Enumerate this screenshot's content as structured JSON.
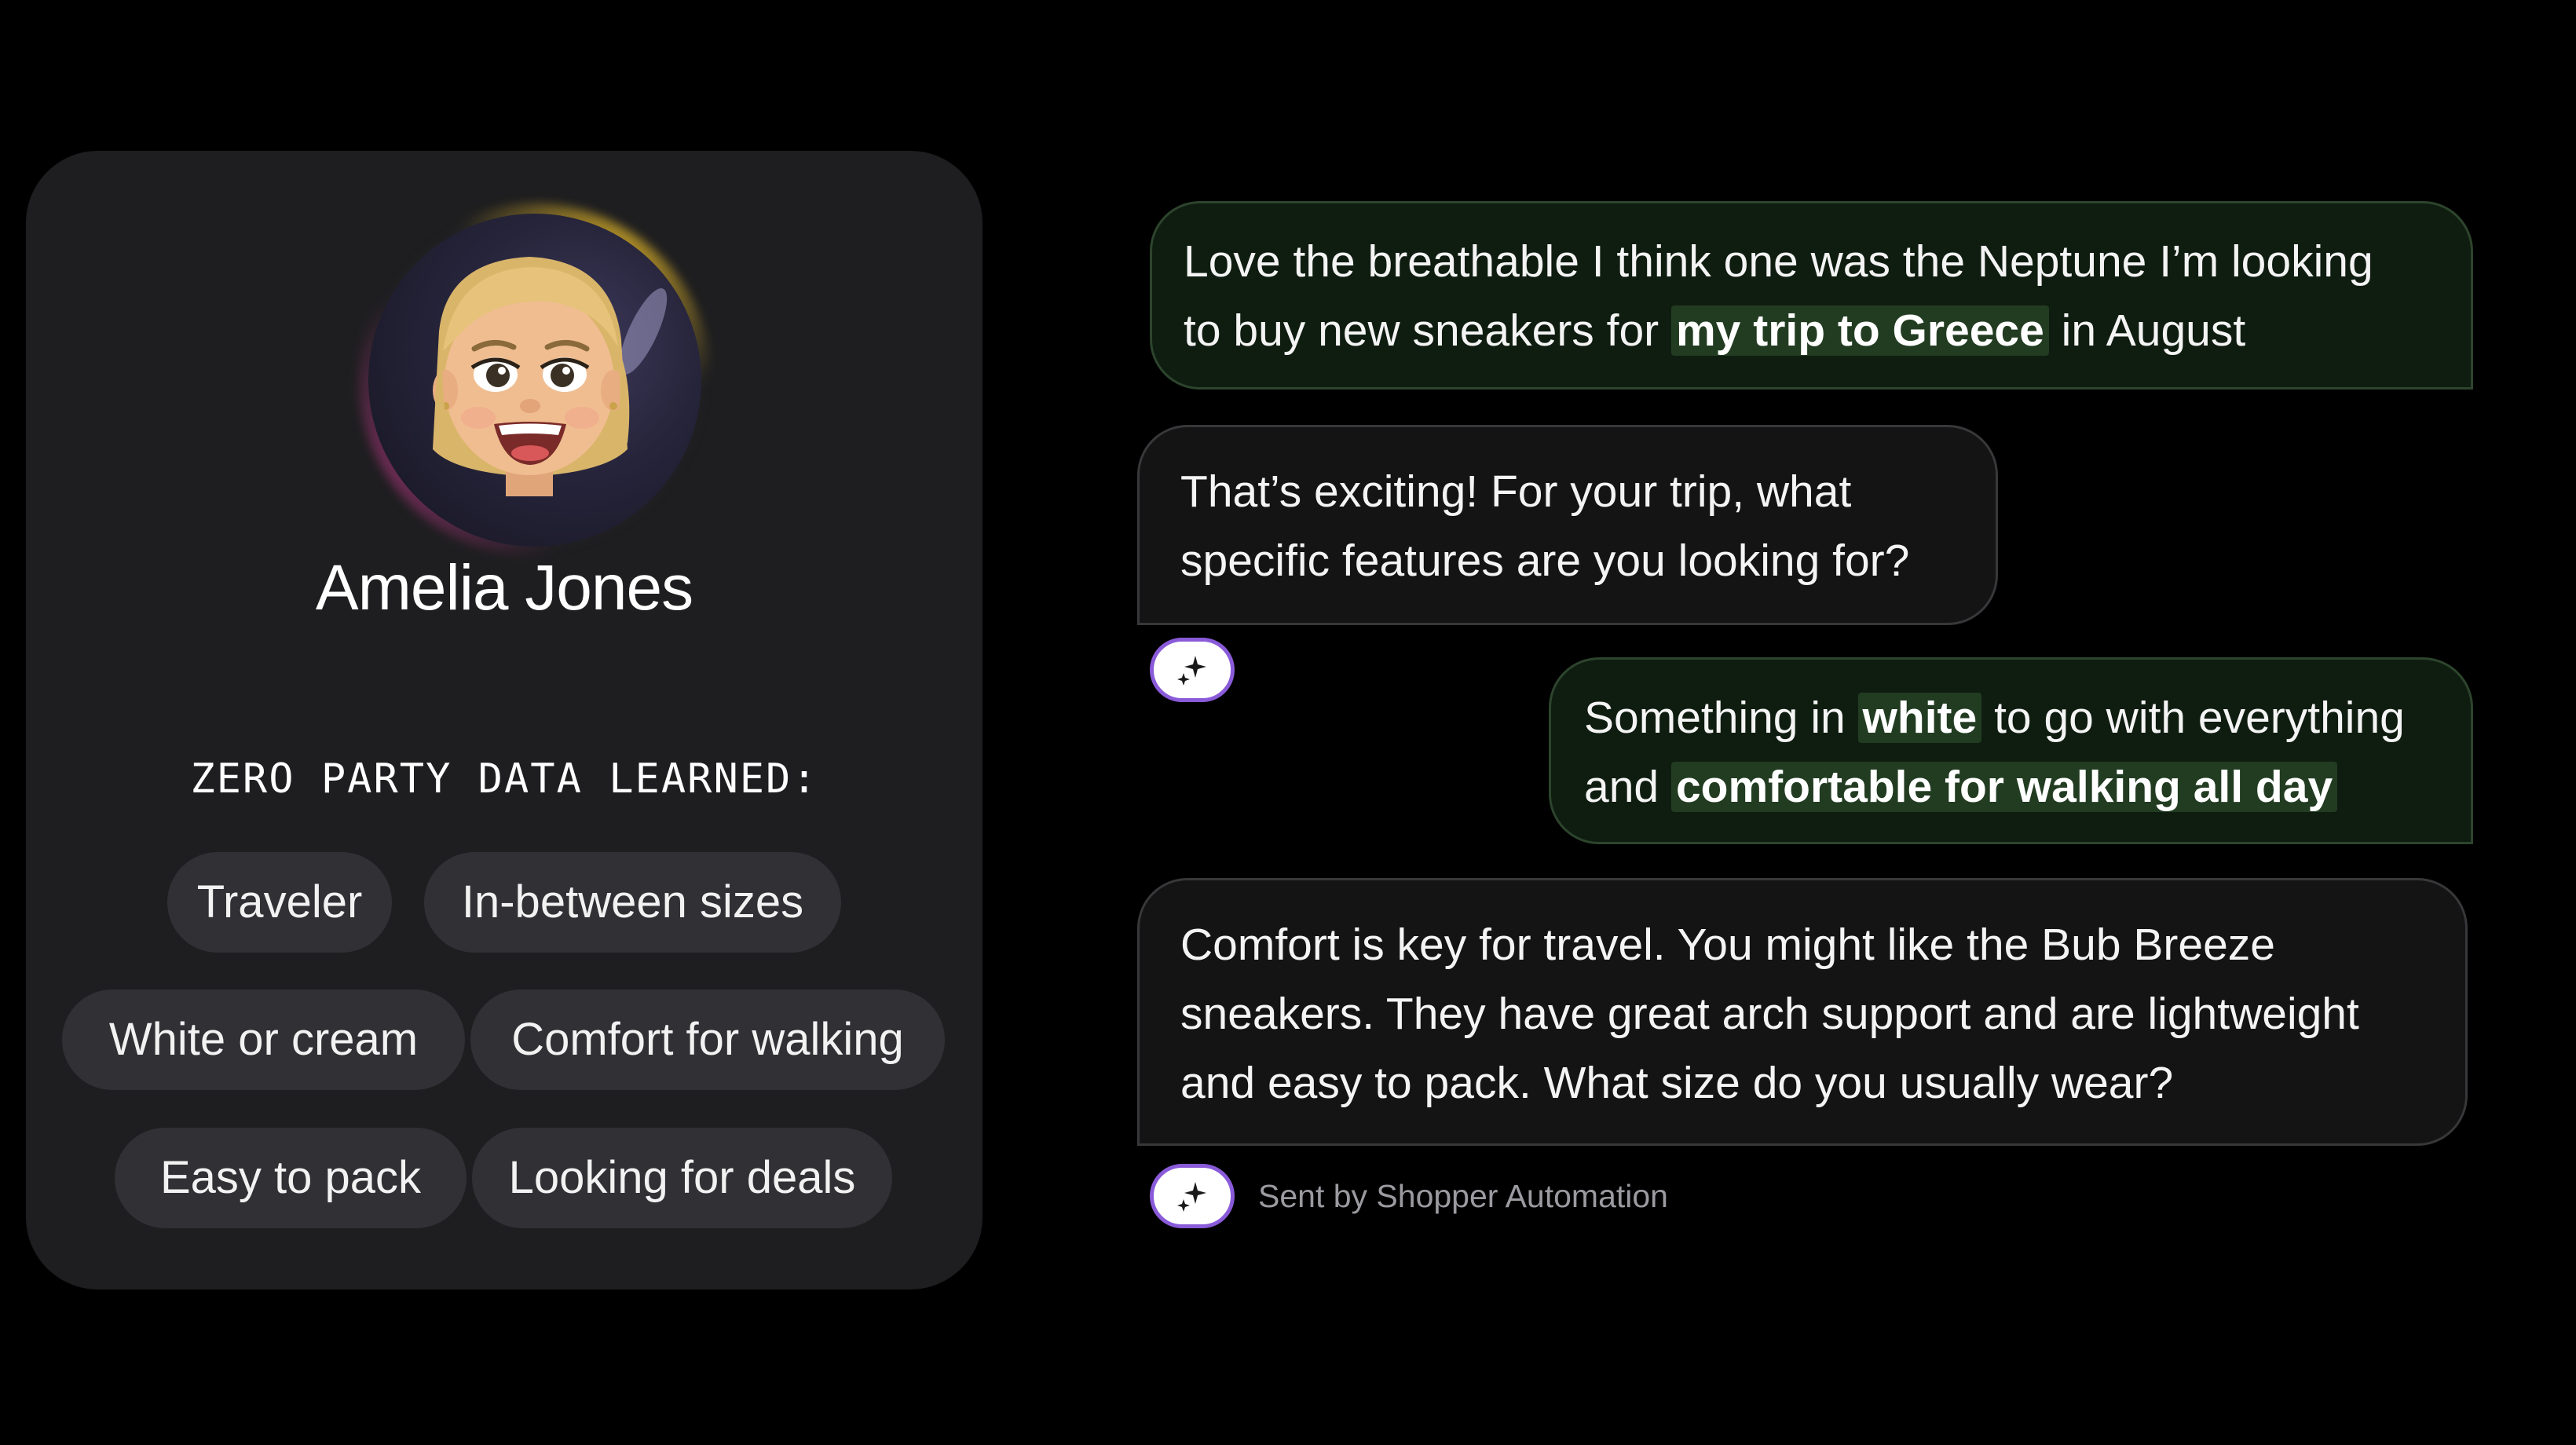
{
  "profile": {
    "name": "Amelia Jones",
    "section_heading": "ZERO PARTY DATA LEARNED:",
    "tags": [
      "Traveler",
      "In-between sizes",
      "White or cream",
      "Comfort for walking",
      "Easy to pack",
      "Looking for deals"
    ]
  },
  "chat": {
    "messages": [
      {
        "sender": "user",
        "lines": [
          [
            "Love the breathable I think one was the Neptune I’m looking"
          ],
          [
            "to buy new sneakers for ",
            "my trip to Greece",
            " in August"
          ]
        ]
      },
      {
        "sender": "bot",
        "lines": [
          [
            "That’s exciting! For your trip, what"
          ],
          [
            "specific features are you looking for?"
          ]
        ]
      },
      {
        "sender": "user",
        "lines": [
          [
            "Something in ",
            "white",
            " to go with everything"
          ],
          [
            "and ",
            "comfortable for walking all day"
          ]
        ]
      },
      {
        "sender": "bot",
        "lines": [
          [
            "Comfort is key for travel. You might like the Bub Breeze"
          ],
          [
            "sneakers. They have great arch support and are lightweight"
          ],
          [
            "and easy to pack. What size do you usually wear?"
          ]
        ]
      }
    ],
    "sent_by_label": "Sent by Shopper Automation"
  },
  "icons": {
    "badge_icon": "sparkle-icon",
    "avatar": "memoji-avatar"
  },
  "colors": {
    "background": "#000000",
    "card": "#1e1e20",
    "tag": "#313035",
    "user_bubble": "#0f1d10",
    "user_highlight": "#223c22",
    "bot_bubble": "#141415",
    "badge_border": "#8a5bd9"
  }
}
